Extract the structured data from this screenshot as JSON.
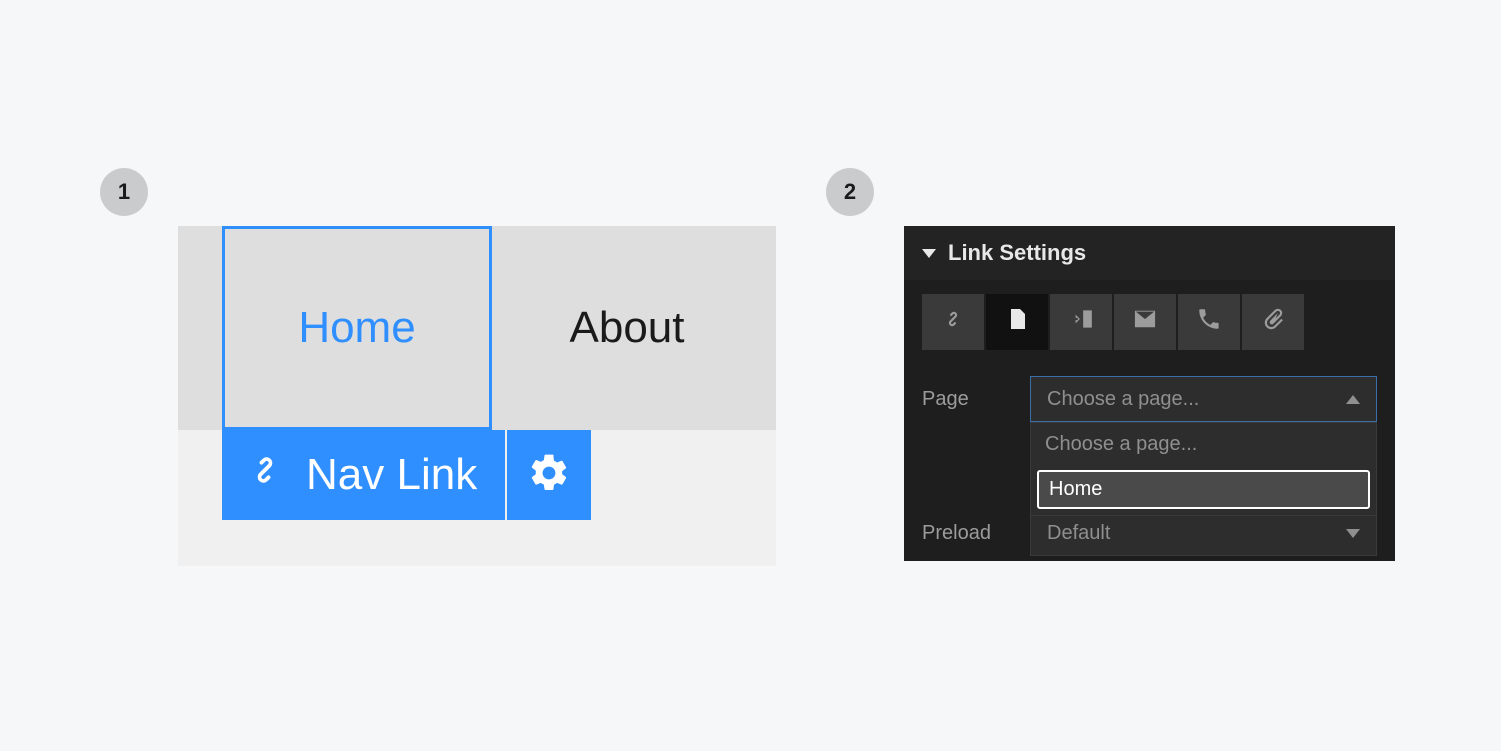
{
  "steps": {
    "one": "1",
    "two": "2"
  },
  "panel1": {
    "nav": {
      "home": "Home",
      "about": "About"
    },
    "element_tag": {
      "label": "Nav Link"
    }
  },
  "panel2": {
    "title": "Link Settings",
    "page_label": "Page",
    "page_placeholder": "Choose a page...",
    "page_options": {
      "placeholder": "Choose a page...",
      "home": "Home"
    },
    "preload_label": "Preload",
    "preload_value": "Default"
  }
}
